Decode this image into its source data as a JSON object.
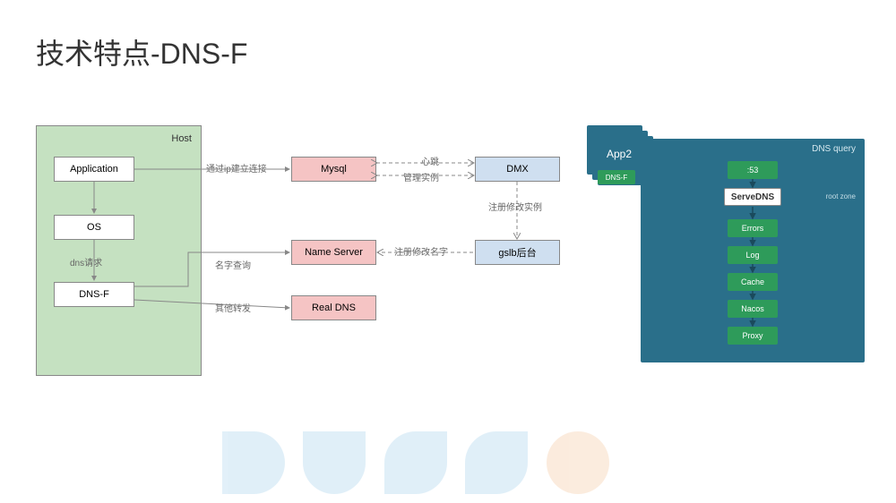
{
  "title": "技术特点-DNS-F",
  "host": {
    "label": "Host",
    "application": "Application",
    "os": "OS",
    "dnsf": "DNS-F",
    "dns_request": "dns请求"
  },
  "middle": {
    "mysql": "Mysql",
    "nameserver": "Name Server",
    "realdns": "Real DNS"
  },
  "right": {
    "dmx": "DMX",
    "gslb": "gslb后台"
  },
  "labels": {
    "connect_via_ip": "通过ip建立连接",
    "heartbeat": "心跳",
    "manage_instance": "管理实例",
    "register_modify_instance": "注册修改实例",
    "register_modify_name": "注册修改名字",
    "name_query": "名字查询",
    "other_forward": "其他转发"
  },
  "dns_chain": {
    "app2": "App2",
    "dnsf_mini": "DNS-F",
    "dns_query": "DNS query",
    "port": ":53",
    "servedns": "ServeDNS",
    "root_zone": "root zone",
    "chain": [
      "Errors",
      "Log",
      "Cache",
      "Nacos",
      "Proxy"
    ]
  }
}
